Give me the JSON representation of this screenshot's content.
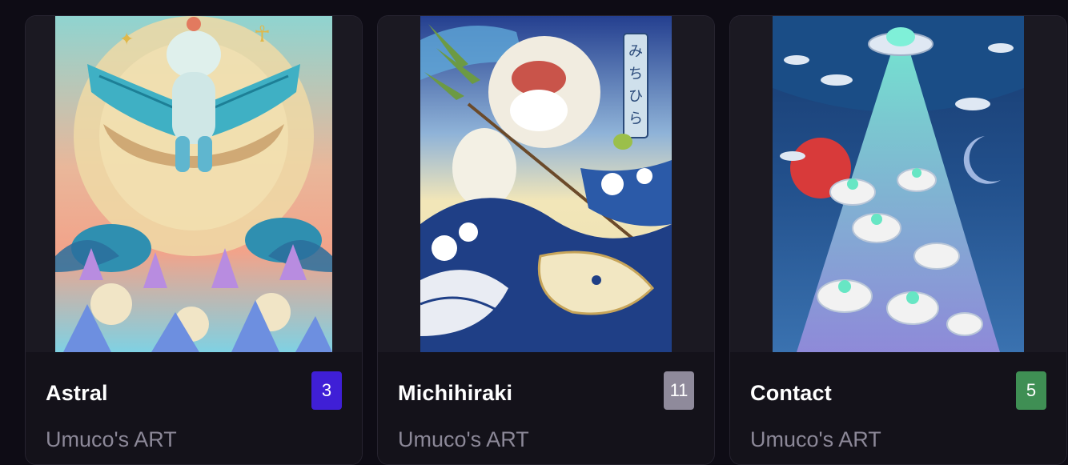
{
  "cards": [
    {
      "title": "Astral",
      "count": "3",
      "author": "Umuco's ART",
      "badge_color": "#3f1fd6",
      "artwork_icon": "astral-artwork-icon"
    },
    {
      "title": "Michihiraki",
      "count": "11",
      "author": "Umuco's ART",
      "badge_color": "#8f8a9b",
      "artwork_icon": "michihiraki-artwork-icon"
    },
    {
      "title": "Contact",
      "count": "5",
      "author": "Umuco's ART",
      "badge_color": "#3f8f54",
      "artwork_icon": "contact-artwork-icon"
    }
  ]
}
